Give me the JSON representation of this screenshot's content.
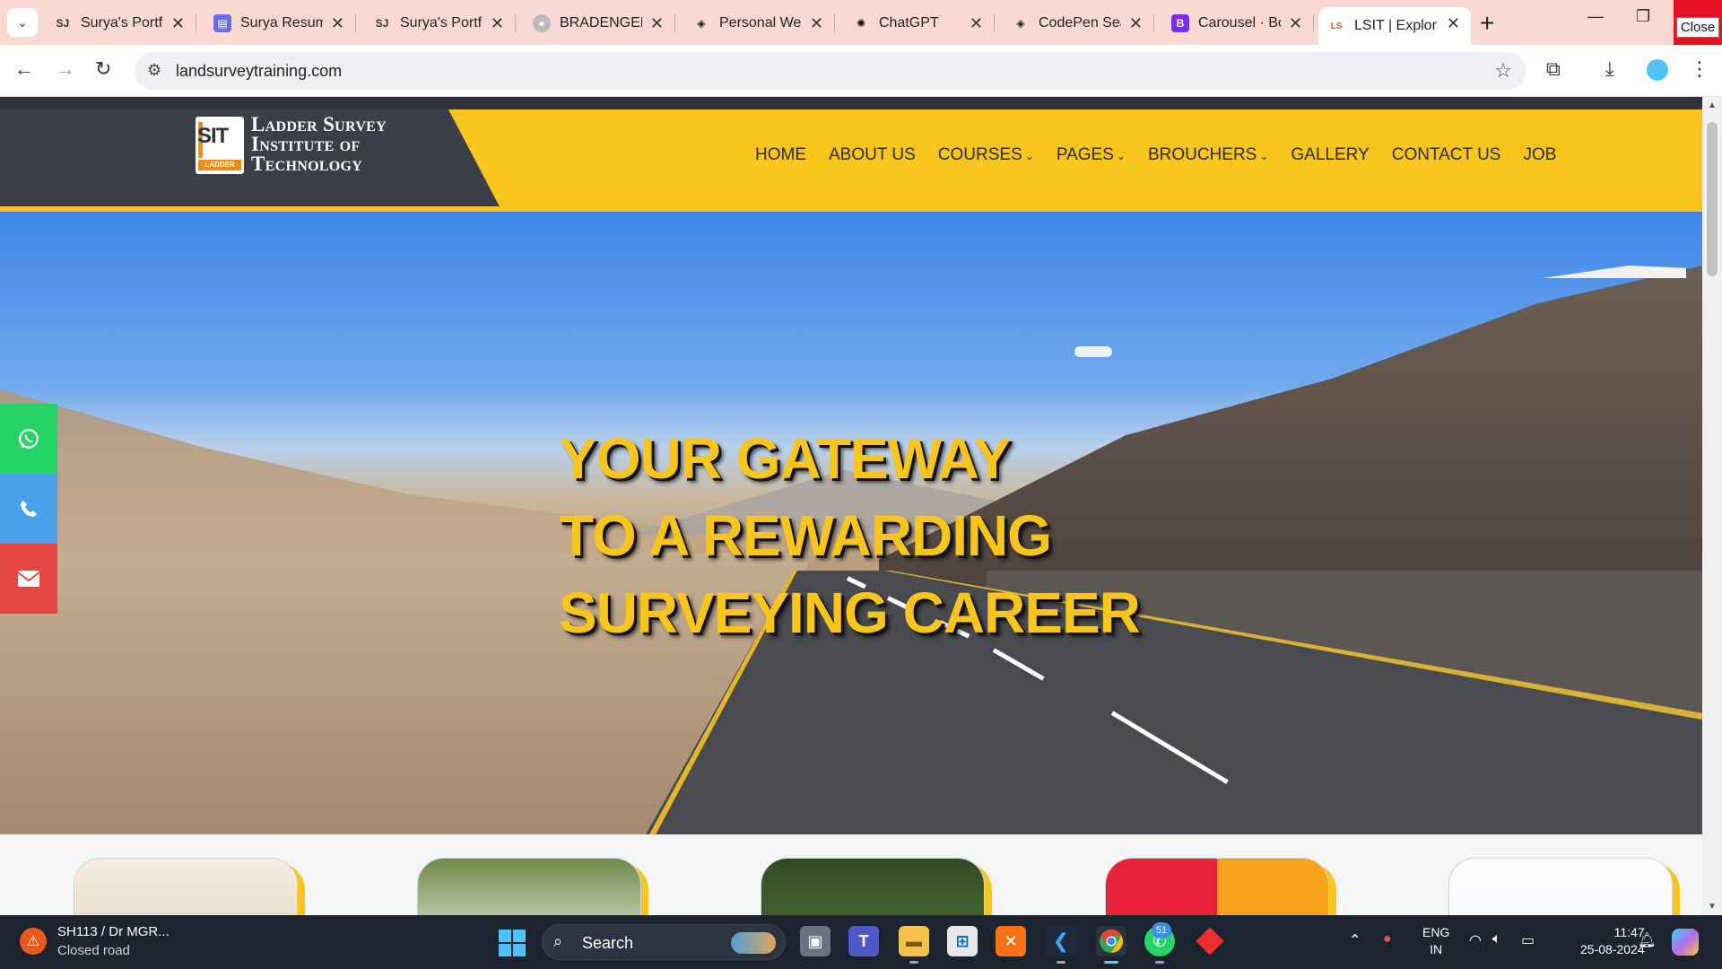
{
  "browser": {
    "tabs": [
      {
        "title": "Surya's Portfolio",
        "favicon": "SJ"
      },
      {
        "title": "Surya Resume",
        "favicon": "printer"
      },
      {
        "title": "Surya's Portfolio",
        "favicon": "SJ"
      },
      {
        "title": "BRADENGELH",
        "favicon": "globe"
      },
      {
        "title": "Personal Web",
        "favicon": "codepen"
      },
      {
        "title": "ChatGPT",
        "favicon": "openai"
      },
      {
        "title": "CodePen Sear",
        "favicon": "codepen"
      },
      {
        "title": "Carousel · Bo",
        "favicon": "B"
      },
      {
        "title": "LSIT | Explore",
        "favicon": "LSIT",
        "active": true
      }
    ],
    "close_tooltip": "Close",
    "url": "landsurveytraining.com"
  },
  "site": {
    "logo_mark": "SIT",
    "logo_ladder": "LADDER",
    "logo_lines": [
      "Ladder Survey",
      "Institute of",
      "Technology"
    ],
    "nav": [
      {
        "label": "HOME",
        "dropdown": false
      },
      {
        "label": "ABOUT US",
        "dropdown": false
      },
      {
        "label": "COURSES",
        "dropdown": true
      },
      {
        "label": "PAGES",
        "dropdown": true
      },
      {
        "label": "BROUCHERS",
        "dropdown": true
      },
      {
        "label": "GALLERY",
        "dropdown": false
      },
      {
        "label": "CONTACT US",
        "dropdown": false
      },
      {
        "label": "JOB",
        "dropdown": false
      }
    ],
    "hero_lines": [
      "YOUR GATEWAY",
      "TO A REWARDING",
      "SURVEYING CAREER"
    ],
    "social": [
      "whatsapp-icon",
      "phone-icon",
      "email-icon"
    ]
  },
  "taskbar": {
    "weather_title": "SH113 / Dr MGR...",
    "weather_sub": "Closed road",
    "search_label": "Search",
    "whatsapp_badge": "51",
    "lang_top": "ENG",
    "lang_bottom": "IN",
    "time": "11:47",
    "date": "25-08-2024"
  },
  "colors": {
    "brand_yellow": "#f8c51c",
    "brand_dark": "#3b4048",
    "whatsapp": "#25d366",
    "phone": "#4aa3ea",
    "email": "#e4473f"
  }
}
